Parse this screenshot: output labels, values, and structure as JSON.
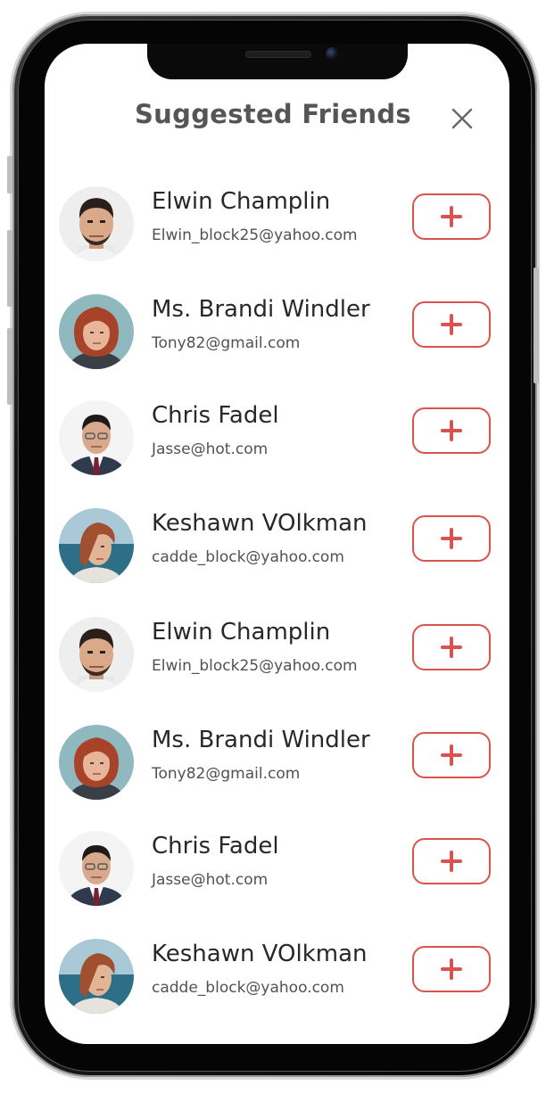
{
  "header": {
    "title": "Suggested Friends",
    "close_icon": "close-icon"
  },
  "colors": {
    "accent": "#d9534f",
    "title": "#555555",
    "name": "#2c2626",
    "email": "#555050"
  },
  "friends": [
    {
      "name": "Elwin Champlin",
      "email": "Elwin_block25@yahoo.com",
      "avatar": "man-beard-avatar"
    },
    {
      "name": "Ms. Brandi Windler",
      "email": "Tony82@gmail.com",
      "avatar": "woman-red-hair-avatar"
    },
    {
      "name": "Chris Fadel",
      "email": "Jasse@hot.com",
      "avatar": "man-suit-glasses-avatar"
    },
    {
      "name": "Keshawn VOlkman",
      "email": "cadde_block@yahoo.com",
      "avatar": "woman-sea-avatar"
    },
    {
      "name": "Elwin Champlin",
      "email": "Elwin_block25@yahoo.com",
      "avatar": "man-beard-avatar"
    },
    {
      "name": "Ms. Brandi Windler",
      "email": "Tony82@gmail.com",
      "avatar": "woman-red-hair-avatar"
    },
    {
      "name": "Chris Fadel",
      "email": "Jasse@hot.com",
      "avatar": "man-suit-glasses-avatar"
    },
    {
      "name": "Keshawn VOlkman",
      "email": "cadde_block@yahoo.com",
      "avatar": "woman-sea-avatar"
    }
  ],
  "add_button_icon": "plus-icon"
}
